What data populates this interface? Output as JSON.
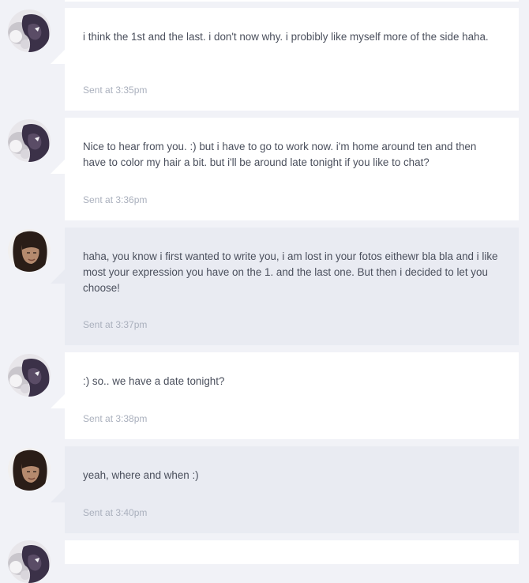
{
  "messages": [
    {
      "sender": "self",
      "text": "i think the 1st and the last. i don't now why. i probibly like myself more of the side haha.",
      "time": "Sent at 3:35pm"
    },
    {
      "sender": "self",
      "text": "Nice to hear from you. :) but i have to go to work now. i'm home around ten and then have to color my hair a bit. but i'll be around late tonight if you like to chat?",
      "time": "Sent at 3:36pm"
    },
    {
      "sender": "other",
      "text": "haha, you know i first wanted to write you, i am lost in your fotos eithewr bla bla and i like most your expression you have on the 1. and the last one. But then i decided to let you choose!",
      "time": "Sent at 3:37pm"
    },
    {
      "sender": "self",
      "text": ":) so.. we have a date tonight?",
      "time": "Sent at 3:38pm"
    },
    {
      "sender": "other",
      "text": "yeah, where and when :)",
      "time": "Sent at 3:40pm"
    }
  ],
  "colors": {
    "page_bg": "#f1f2f7",
    "self_bubble": "#ffffff",
    "other_bubble": "#e9ebf2",
    "text": "#4a4f5c",
    "timestamp": "#aab0bd"
  }
}
